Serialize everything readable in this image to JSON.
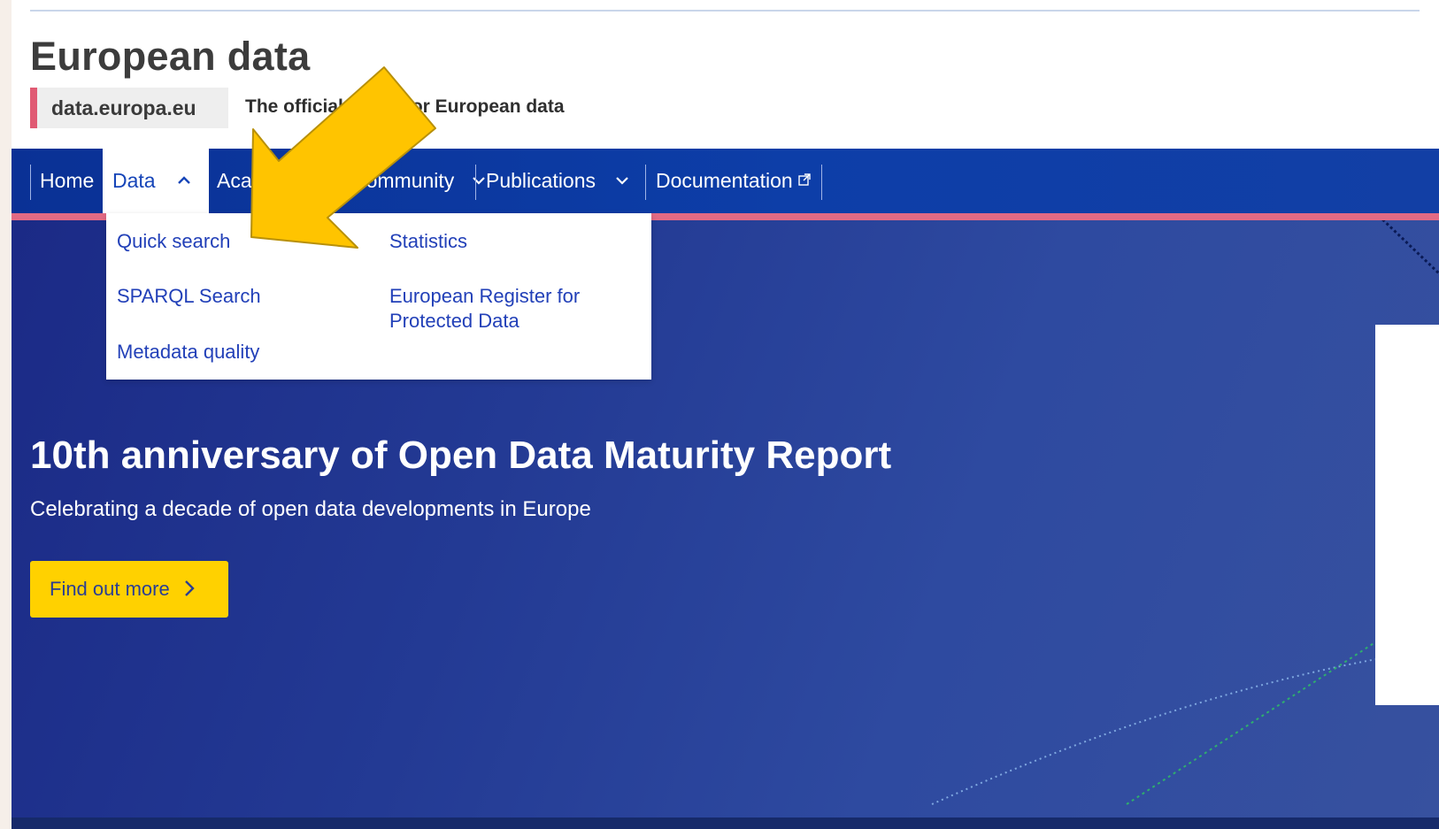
{
  "header": {
    "site_title": "European data",
    "site_tag": "data.europa.eu",
    "tagline": "The official portal for European data"
  },
  "nav": {
    "items": [
      {
        "label": "Home"
      },
      {
        "label": "Data",
        "expanded": true
      },
      {
        "label": "Academy"
      },
      {
        "label": "Community"
      },
      {
        "label": "Publications"
      },
      {
        "label": "Documentation"
      }
    ]
  },
  "data_menu": {
    "col1": [
      "Quick search",
      "SPARQL Search",
      "Metadata quality"
    ],
    "col2": [
      "Statistics",
      "European Register for",
      "Protected Data"
    ]
  },
  "hero": {
    "title": "10th anniversary of Open Data Maturity Report",
    "subtitle": "Celebrating a decade of open data developments in Europe",
    "cta_label": "Find out more"
  },
  "icons": {
    "chevron_up": "chevron-up-icon",
    "chevron_down": "chevron-down-icon",
    "external_link": "external-link-icon",
    "chevron_right": "chevron-right-icon",
    "annotation_arrow": "annotation-arrow-icon"
  },
  "colors": {
    "nav_bg": "#0d3ea8",
    "accent_pink": "#e26a84",
    "cta_yellow": "#ffd100",
    "link_blue": "#2240b8",
    "annotation_arrow": "#ffc400"
  }
}
